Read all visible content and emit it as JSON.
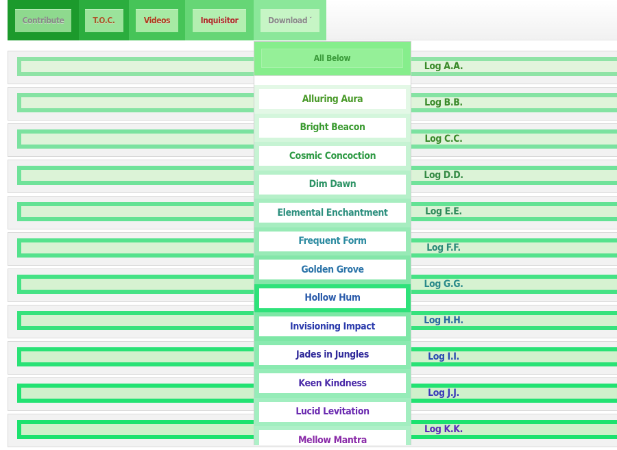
{
  "nav": {
    "items": [
      {
        "label": "Contribute",
        "tab_bg": "#1c9a2c",
        "btn_bg": "#8ed98e",
        "color": "#8a8a8a",
        "tab_w": 104,
        "btn_w": 82
      },
      {
        "label": "T.O.C.",
        "tab_bg": "#2bad3e",
        "btn_bg": "#9be39b",
        "color": "#a85a2a",
        "tab_w": 73,
        "btn_w": 56
      },
      {
        "label": "Videos",
        "tab_bg": "#46c458",
        "btn_bg": "#a7eaa4",
        "color": "#b03a1e",
        "tab_w": 82,
        "btn_w": 62
      },
      {
        "label": "Inquisitor",
        "tab_bg": "#66d676",
        "btn_bg": "#b3efb0",
        "color": "#b02a2a",
        "tab_w": 100,
        "btn_w": 78
      },
      {
        "label": "Download",
        "tab_bg": "#8be79a",
        "btn_bg": "#c6f5c5",
        "color": "#8a8a8a",
        "tab_w": 106,
        "btn_w": 86,
        "caret": "ˇ"
      }
    ]
  },
  "logs": [
    {
      "label": "Log A.A.",
      "color": "#3a8a2a",
      "border": "#8fe3a6",
      "fill": "#e2f4dc"
    },
    {
      "label": "Log B.B.",
      "color": "#3a8a2a",
      "border": "#85e3a3",
      "fill": "#e0f4da"
    },
    {
      "label": "Log C.C.",
      "color": "#3a8a2a",
      "border": "#7be2a0",
      "fill": "#def3d9"
    },
    {
      "label": "Log D.D.",
      "color": "#348a44",
      "border": "#70e29a",
      "fill": "#dcf3d7"
    },
    {
      "label": "Log E.E.",
      "color": "#2f8a5a",
      "border": "#63e294",
      "fill": "#daf2d5"
    },
    {
      "label": "Log F.F.",
      "color": "#2a8a78",
      "border": "#55e28d",
      "fill": "#d8f2d3"
    },
    {
      "label": "Log G.G.",
      "color": "#2a8a8a",
      "border": "#45e285",
      "fill": "#d6f2d1"
    },
    {
      "label": "Log H.H.",
      "color": "#2a6aa0",
      "border": "#36e27c",
      "fill": "#d4f1cf"
    },
    {
      "label": "Log I.I.",
      "color": "#2a4ab0",
      "border": "#2ae276",
      "fill": "#d2f1cd"
    },
    {
      "label": "Log J.J.",
      "color": "#3a3ab8",
      "border": "#22e272",
      "fill": "#d0f0cb"
    },
    {
      "label": "Log K.K.",
      "color": "#5a2ab8",
      "border": "#1ce26e",
      "fill": "#cef0c9"
    }
  ],
  "dropdown": {
    "all_label": "All Below",
    "items": [
      {
        "label": "Alluring Aura",
        "color": "#4a9a2a",
        "bg": "#e3f8e6"
      },
      {
        "label": "Bright Beacon",
        "color": "#3a9a30",
        "bg": "#d4f6dc"
      },
      {
        "label": "Cosmic Concoction",
        "color": "#2f9a45",
        "bg": "#c6f3d3"
      },
      {
        "label": "Dim Dawn",
        "color": "#2e9466",
        "bg": "#b6f0c9"
      },
      {
        "label": "Elemental Enchantment",
        "color": "#2d8f7e",
        "bg": "#a7edc0"
      },
      {
        "label": "Frequent Form",
        "color": "#2b8aa0",
        "bg": "#98eab6"
      },
      {
        "label": "Golden Grove",
        "color": "#2a73a8",
        "bg": "#84e6a9"
      },
      {
        "label": "Hollow Hum",
        "color": "#2a5aaa",
        "bg": "#2ee27a"
      },
      {
        "label": "Invisioning Impact",
        "color": "#2a3aac",
        "bg": "#7ee7a6"
      },
      {
        "label": "Jades in Jungles",
        "color": "#302a9a",
        "bg": "#8aeab0"
      },
      {
        "label": "Keen Kindness",
        "color": "#4a2aa8",
        "bg": "#96ecb8"
      },
      {
        "label": "Lucid Levitation",
        "color": "#6a2ab0",
        "bg": "#a2eec0"
      },
      {
        "label": "Mellow Mantra",
        "color": "#8a2aa8",
        "bg": "#aef0c8"
      }
    ]
  }
}
